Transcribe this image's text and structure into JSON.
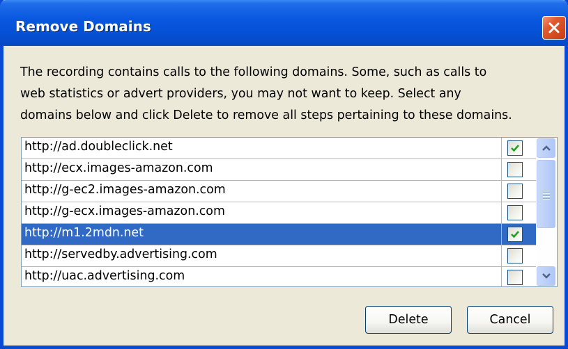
{
  "dialog": {
    "title": "Remove Domains",
    "description_lines": [
      "The recording contains calls to the following domains.  Some, such as calls to",
      "web statistics or advert providers, you may not want to keep.  Select any",
      "domains below and click Delete to remove all steps pertaining to these domains."
    ]
  },
  "domains": [
    {
      "url": "http://ad.doubleclick.net",
      "checked": true,
      "selected": false
    },
    {
      "url": "http://ecx.images-amazon.com",
      "checked": false,
      "selected": false
    },
    {
      "url": "http://g-ec2.images-amazon.com",
      "checked": false,
      "selected": false
    },
    {
      "url": "http://g-ecx.images-amazon.com",
      "checked": false,
      "selected": false
    },
    {
      "url": "http://m1.2mdn.net",
      "checked": true,
      "selected": true
    },
    {
      "url": "http://servedby.advertising.com",
      "checked": false,
      "selected": false
    },
    {
      "url": "http://uac.advertising.com",
      "checked": false,
      "selected": false
    }
  ],
  "buttons": {
    "delete_label": "Delete",
    "cancel_label": "Cancel"
  },
  "icons": {
    "close": "close-icon",
    "check": "check-icon",
    "scroll_up": "chevron-up-icon",
    "scroll_down": "chevron-down-icon"
  },
  "colors": {
    "titlebar": "#0a58e0",
    "selection": "#316ac5",
    "checkmark": "#21a121",
    "close_button": "#e05a30"
  }
}
